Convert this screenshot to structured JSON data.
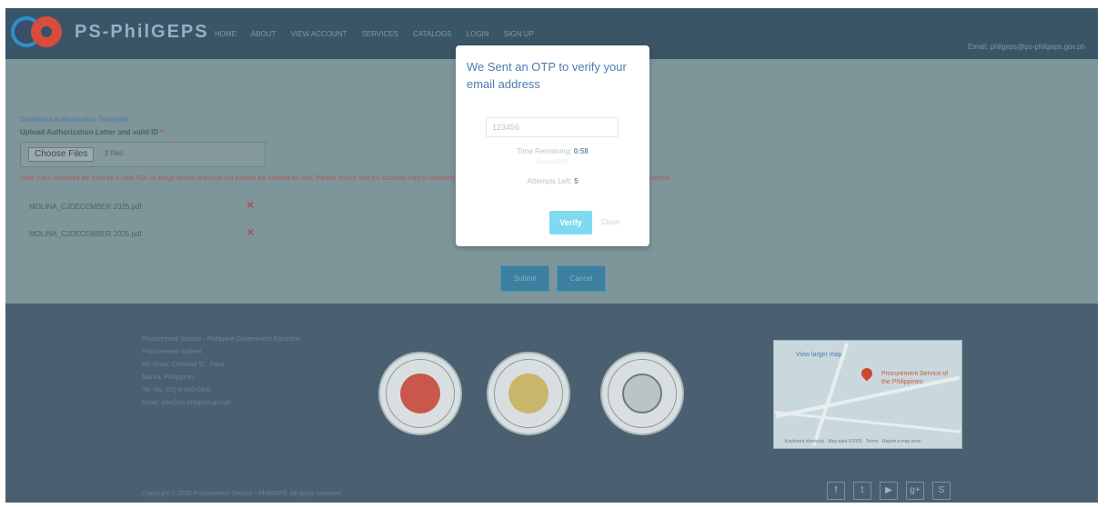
{
  "navbar": {
    "brand": "PS-PhilGEPS",
    "links": [
      "HOME",
      "ABOUT",
      "VIEW ACCOUNT",
      "SERVICES",
      "CATALOGS",
      "LOGIN",
      "SIGN UP"
    ],
    "right_text": "Email: philgeps@ps-philgeps.gov.ph"
  },
  "content": {
    "download_link": "Download Authorization Template",
    "upload_label": "Upload Authorization Letter and valid ID",
    "upload_required": "*",
    "file_button": "Choose Files",
    "file_count": "2 files",
    "warning": "Note: Each uploaded file must be a valid PDF or image format and must not exceed the allowed file size. Please ensure that the scanned copy is complete and clearly legible before submitting your registration for verification.",
    "warning_tail": "verifier",
    "files": [
      {
        "name": "MOLINA_CJDECEMBER 2025.pdf",
        "remove": "✕"
      },
      {
        "name": "MOLINA_CJDECEMBER 2025.pdf",
        "remove": "✕"
      }
    ],
    "buttons": [
      "Submit",
      "Cancel"
    ]
  },
  "footer": {
    "lines": [
      "Procurement Service - Philippine Government Electronic",
      "Procurement System",
      "RR Road, Cristobal St., Paco",
      "Manila, Philippines",
      "Tel. No. (02) 8-640-6900",
      "Email: info@ps-philgeps.gov.ph"
    ],
    "map_title": "View larger map",
    "map_place": "Procurement Service of the Philippines",
    "map_attribution": "Keyboard shortcuts · Map data ©2025 · Terms · Report a map error",
    "copyright": "Copyright © 2025 Procurement Service - PhilGEPS. All rights reserved.",
    "social": [
      {
        "icon": "facebook-icon",
        "glyph": "f"
      },
      {
        "icon": "twitter-icon",
        "glyph": "t"
      },
      {
        "icon": "youtube-icon",
        "glyph": "▶"
      },
      {
        "icon": "google-plus-icon",
        "glyph": "g+"
      },
      {
        "icon": "skype-icon",
        "glyph": "S"
      }
    ]
  },
  "modal": {
    "title": "We Sent an OTP to verify your email address",
    "otp_value": "123456",
    "time_label": "Time Remaining:",
    "time_value": "0:58",
    "resend": "Resend OTP",
    "attempts_label": "Attempts Left:",
    "attempts_value": "5",
    "verify_label": "Verify",
    "close_label": "Close"
  },
  "colors": {
    "overlay": "#7e959a",
    "navbar": "#3a5566",
    "footer": "#4a6070",
    "modal_title": "#4a7db0",
    "verify": "#7fdaf0",
    "danger": "#b04a48"
  }
}
